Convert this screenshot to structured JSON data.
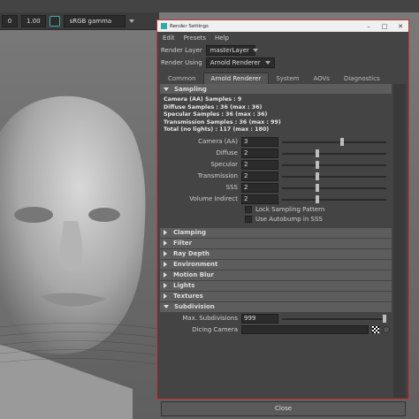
{
  "viewport": {
    "frame_value": "0",
    "gamma_value": "1.00",
    "color_space": "sRGB gamma"
  },
  "dialog": {
    "title": "Render Settings",
    "menu": [
      "Edit",
      "Presets",
      "Help"
    ],
    "render_layer_label": "Render Layer",
    "render_layer_value": "masterLayer",
    "render_using_label": "Render Using",
    "render_using_value": "Arnold Renderer",
    "tabs": [
      "Common",
      "Arnold Renderer",
      "System",
      "AOVs",
      "Diagnostics"
    ],
    "active_tab": "Arnold Renderer",
    "sampling": {
      "header": "Sampling",
      "info": [
        "Camera (AA) Samples : 9",
        "Diffuse Samples : 36 (max : 36)",
        "Specular Samples : 36 (max : 36)",
        "Transmission Samples : 36 (max : 99)",
        "Total (no lights) : 117 (max : 180)"
      ],
      "params": [
        {
          "label": "Camera (AA)",
          "value": "3",
          "level": 0.58
        },
        {
          "label": "Diffuse",
          "value": "2",
          "level": 0.33
        },
        {
          "label": "Specular",
          "value": "2",
          "level": 0.33
        },
        {
          "label": "Transmission",
          "value": "2",
          "level": 0.33
        },
        {
          "label": "SSS",
          "value": "2",
          "level": 0.33
        },
        {
          "label": "Volume Indirect",
          "value": "2",
          "level": 0.33
        }
      ],
      "lock_pattern_label": "Lock Sampling Pattern",
      "autobump_label": "Use Autobump in SSS"
    },
    "sections": [
      "Clamping",
      "Filter",
      "Ray Depth",
      "Environment",
      "Motion Blur",
      "Lights",
      "Textures"
    ],
    "subdivision": {
      "header": "Subdivision",
      "max_label": "Max. Subdivisions",
      "max_value": "999",
      "max_level": 1.0,
      "dicing_label": "Dicing Camera"
    },
    "close_label": "Close"
  }
}
